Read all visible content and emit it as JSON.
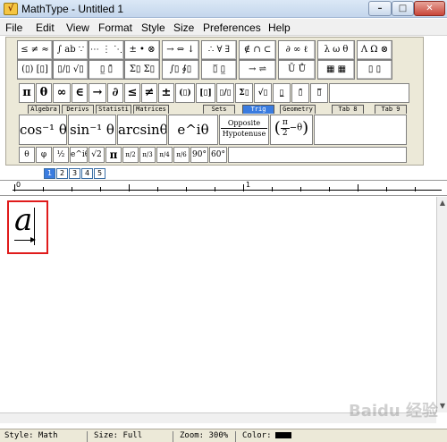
{
  "window": {
    "title": "MathType - Untitled 1",
    "app_icon": "mathtype-icon",
    "buttons": {
      "minimize": "–",
      "maximize": "□",
      "close": "✕"
    }
  },
  "menu": [
    "File",
    "Edit",
    "View",
    "Format",
    "Style",
    "Size",
    "Preferences",
    "Help"
  ],
  "palette_row1": [
    "≤ ≠ ≈",
    "∫ ab ∵",
    "⋯ ⋮ ⋱",
    "± • ⊗",
    "→ ⇔ ↓",
    "∴ ∀ ∃",
    "∉ ∩ ⊂",
    "∂ ∞ ℓ",
    "λ ω θ",
    "Λ Ω ⊗"
  ],
  "palette_row2": [
    "(▯) [▯]",
    "▯/▯ √▯",
    "▯̲ ▯̄",
    "Σ▯ Σ▯",
    "∫▯ ∮▯",
    "▯̅ ▯̲",
    "→ ⇌",
    "Ū Ů",
    "▦ ▦",
    "▯ ▯"
  ],
  "symbol_row": [
    "π",
    "θ",
    "∞",
    "∈",
    "→",
    "∂",
    "≤",
    "≠",
    "±",
    "(▯)",
    "[▯]",
    "▯/▯",
    "Σ▯",
    "√▯",
    "▯̲",
    "▯̄",
    "▯̅"
  ],
  "tabs": [
    "Algebra",
    "Derivs",
    "Statisti",
    "Matrices",
    "Sets",
    "Trig",
    "Geometry",
    "Tab 8",
    "Tab 9"
  ],
  "active_tab": "Trig",
  "big_templates": {
    "cos_inv": "cos⁻¹ θ",
    "sin_inv": "sin⁻¹ θ",
    "arcsin": "arcsinθ",
    "exp": "e^iθ",
    "opposite": "Opposite",
    "hypotenuse": "Hypotenuse",
    "pi_frac_num": "π",
    "pi_frac_den": "2",
    "pi_minus": "−θ"
  },
  "small_templates": [
    "θ",
    "φ",
    "½",
    "e^iθ",
    "√2",
    "π",
    "π/2",
    "π/3",
    "π/4",
    "π/6",
    "90°",
    "60°"
  ],
  "size_buttons": [
    "1",
    "2",
    "3",
    "4",
    "5"
  ],
  "ruler": {
    "labels": [
      "0",
      "1"
    ]
  },
  "equation": {
    "variable": "a",
    "vector_arrow": "→"
  },
  "status": {
    "style": "Style: Math",
    "size": "Size: Full",
    "zoom": "Zoom: 300%",
    "color": "Color:",
    "color_value": "#000000"
  },
  "watermark": "Baidu 经验"
}
